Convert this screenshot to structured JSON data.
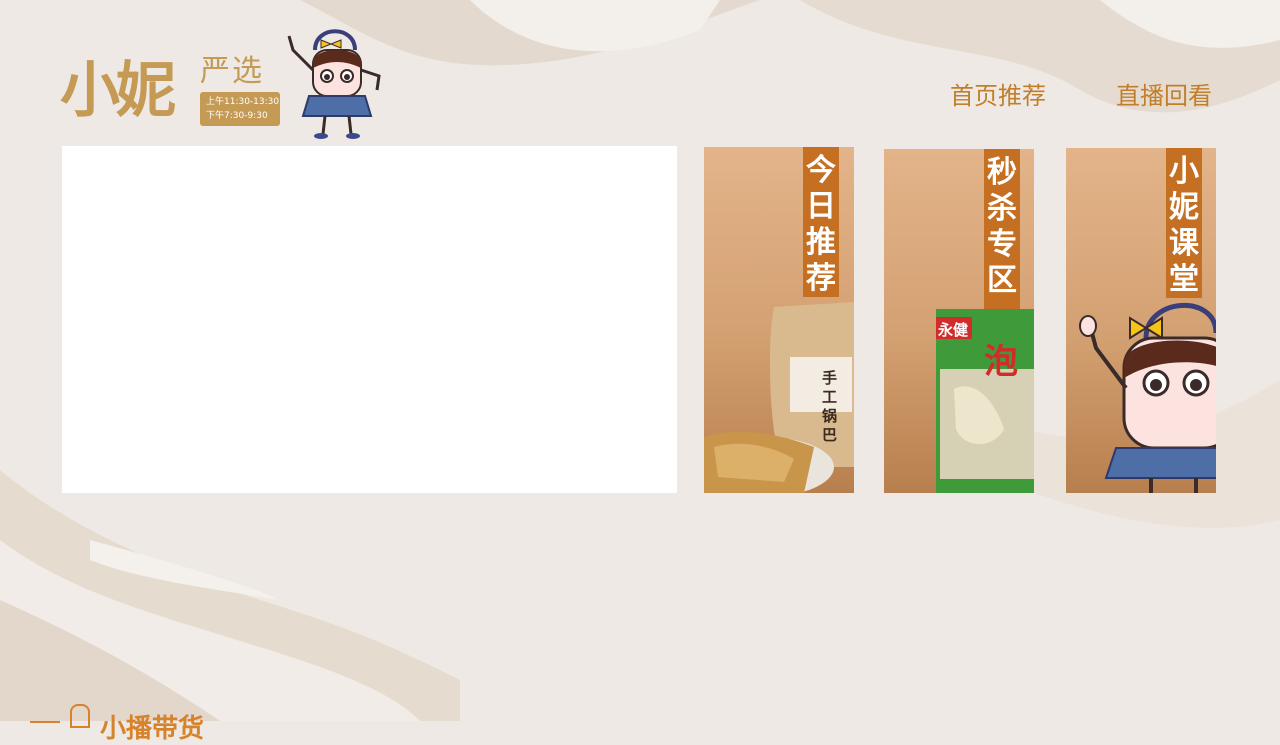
{
  "logo": {
    "main": "小妮",
    "sub": "严选",
    "time_line1": "上午11:30-13:30",
    "time_line2": "下午7:30-9:30",
    "mascot": "mascot-girl-icon"
  },
  "nav": {
    "home": "首页推荐",
    "replay": "直播回看"
  },
  "cards": [
    {
      "tag": "今日推荐",
      "product_label": "手工锅巴"
    },
    {
      "tag": "秒杀专区",
      "product_brand": "永健",
      "product_big": "泡"
    },
    {
      "tag": "小妮课堂"
    }
  ],
  "section": {
    "title": "小播带货"
  },
  "colors": {
    "accent": "#c17f2b",
    "card_tag": "#c56f22",
    "logo": "#c49a55",
    "background": "#eee9e4"
  }
}
